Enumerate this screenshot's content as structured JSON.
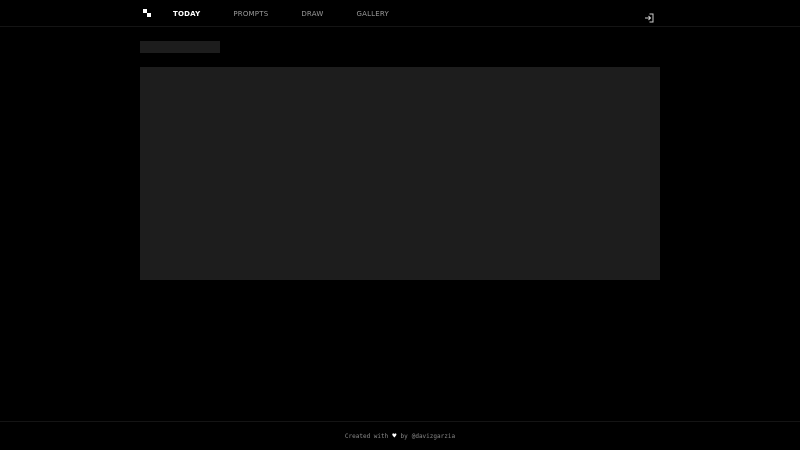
{
  "nav": {
    "items": [
      {
        "label": "TODAY",
        "active": true
      },
      {
        "label": "PROMPTS",
        "active": false
      },
      {
        "label": "DRAW",
        "active": false
      },
      {
        "label": "GALLERY",
        "active": false
      }
    ],
    "login_icon": "sign-in-icon",
    "logo_icon": "pixel-logo-icon"
  },
  "footer": {
    "created_with": "Created with",
    "heart": "♥",
    "by": "by",
    "handle": "@davizgarzia"
  },
  "colors": {
    "background": "#000000",
    "panel": "#1d1d1d",
    "active_nav": "#ffffff",
    "inactive_nav": "#9a9a9a"
  }
}
